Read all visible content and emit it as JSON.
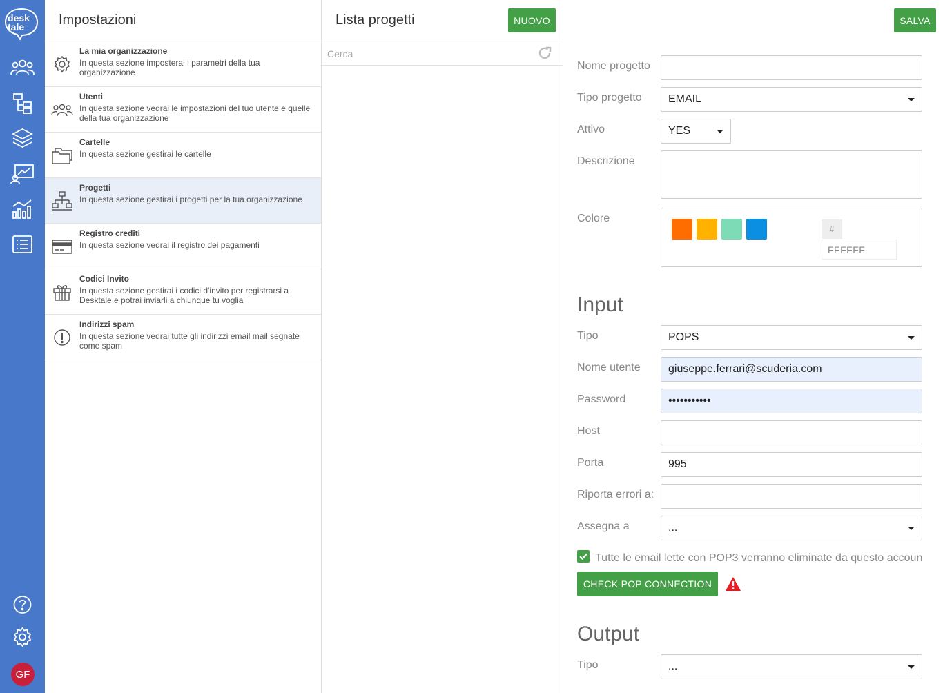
{
  "brand": {
    "logo_line1": "desk",
    "logo_line2": "tale"
  },
  "rail": {
    "icons": [
      "users-icon",
      "folder-tree-icon",
      "layers-icon",
      "analytics-icon",
      "chart-icon",
      "list-icon"
    ],
    "bottom_icons": [
      "help-icon",
      "gear-icon"
    ],
    "avatar_initials": "GF"
  },
  "settings": {
    "title": "Impostazioni",
    "items": [
      {
        "title": "La mia organizzazione",
        "desc": "In questa sezione imposterai i parametri della tua organizzazione",
        "icon": "gear-icon"
      },
      {
        "title": "Utenti",
        "desc": "In questa sezione vedrai le impostazioni del tuo utente e quelle della tua organizzazione",
        "icon": "users-icon"
      },
      {
        "title": "Cartelle",
        "desc": "In questa sezione gestirai le cartelle",
        "icon": "folders-icon"
      },
      {
        "title": "Progetti",
        "desc": "In questa sezione gestirai i progetti per la tua organizzazione",
        "icon": "sitemap-icon"
      },
      {
        "title": "Registro crediti",
        "desc": "In questa sezione vedrai il registro dei pagamenti",
        "icon": "credit-card-icon"
      },
      {
        "title": "Codici Invito",
        "desc": "In questa sezione gestirai i codici d'invito per registrarsi a Desktale e potrai inviarli a chiunque tu voglia",
        "icon": "gift-icon"
      },
      {
        "title": "Indirizzi spam",
        "desc": "In questa sezione vedrai tutte gli indirizzi email mail segnate come spam",
        "icon": "alert-circle-icon"
      }
    ]
  },
  "projects": {
    "title": "Lista progetti",
    "new_label": "NUOVO",
    "search_placeholder": "Cerca"
  },
  "form": {
    "save_label": "SALVA",
    "labels": {
      "name": "Nome progetto",
      "type": "Tipo progetto",
      "active": "Attivo",
      "description": "Descrizione",
      "color": "Colore"
    },
    "values": {
      "name": "",
      "type": "EMAIL",
      "active": "YES",
      "description": ""
    },
    "colors": [
      "#ff6d00",
      "#ffb300",
      "#7ddbb5",
      "#0b8fe3"
    ],
    "hash_label": "#",
    "hex_value": "FFFFFF",
    "input": {
      "heading": "Input",
      "labels": {
        "type": "Tipo",
        "username": "Nome utente",
        "password": "Password",
        "host": "Host",
        "port": "Porta",
        "errors": "Riporta errori a:",
        "assign": "Assegna a"
      },
      "values": {
        "type": "POPS",
        "username": "giuseppe.ferrari@scuderia.com",
        "password": "•••••••••••",
        "host": "",
        "port": "995",
        "errors": "",
        "assign": "..."
      },
      "checkbox_label": "Tutte le email lette con POP3 verranno eliminate da questo accoun",
      "check_button": "CHECK POP CONNECTION"
    },
    "output": {
      "heading": "Output",
      "labels": {
        "type": "Tipo"
      },
      "values": {
        "type": "..."
      }
    }
  }
}
